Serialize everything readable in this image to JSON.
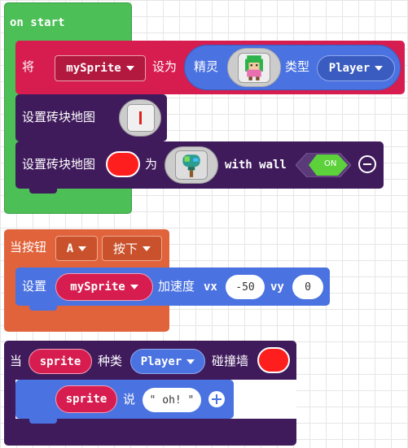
{
  "on_start": {
    "label": "on start",
    "set_block": {
      "prefix": "将",
      "variable": "mySprite",
      "set_to": "设为",
      "sprite_label": "精灵",
      "kind_label": "类型",
      "kind_value": "Player"
    },
    "tilemap_block": {
      "label": "设置砖块地图"
    },
    "tile_block": {
      "label": "设置砖块地图",
      "as_label": "为",
      "with_wall": "with wall",
      "toggle": "ON"
    }
  },
  "on_button": {
    "when_label": "当按钮",
    "button_value": "A",
    "event_value": "按下",
    "velocity_block": {
      "set_label": "设置",
      "variable": "mySprite",
      "velocity_label": "加速度",
      "vx_label": "vx",
      "vx_value": "-50",
      "vy_label": "vy",
      "vy_value": "0"
    }
  },
  "on_overlap": {
    "when_label": "当",
    "sprite_param": "sprite",
    "kind_label": "种类",
    "kind_value": "Player",
    "hits_wall_label": "碰撞墙",
    "say_block": {
      "sprite": "sprite",
      "say_label": "说",
      "message": "\" oh! \""
    }
  },
  "colors": {
    "loops_green": "#4cbf56",
    "sprites_red": "#d71d50",
    "scene_purple": "#401b5c",
    "controller_orange": "#e0633b",
    "kind_blue": "#4a72e0",
    "wall_red": "#ff1e1e",
    "toggle_green": "#5cd13b"
  }
}
